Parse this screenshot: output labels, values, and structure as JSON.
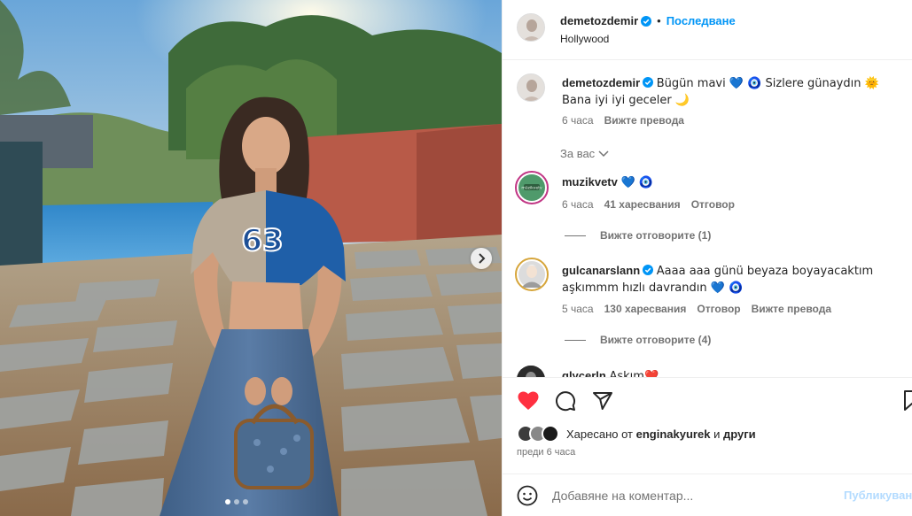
{
  "post": {
    "author": "demetozdemir",
    "follow_label": "Последване",
    "separator": "•",
    "location": "Hollywood",
    "caption_text": "Bügün mavi 💙 🧿 Sizlere günaydın 🌞 Bana iyi iyi geceler 🌙",
    "caption_time": "6 часа",
    "caption_translate": "Вижте превода",
    "for_you_label": "За вас",
    "jersey_number": "63"
  },
  "comments": [
    {
      "username": "muzikvetv",
      "text": "💙 🧿",
      "time": "6 часа",
      "likes": "41 харесвания",
      "reply": "Отговор",
      "view_replies": "Вижте отговорите (1)",
      "avatar_badge": "müzikvetv"
    },
    {
      "username": "gulcanarslann",
      "text": "Aaaa aaa günü beyaza boyayacaktım aşkımmm hızlı davrandın 💙 🧿",
      "time": "5 часа",
      "likes": "130 харесвания",
      "reply": "Отговор",
      "translate": "Вижте превода",
      "view_replies": "Вижте отговорите (4)"
    },
    {
      "username": "glycerln",
      "text": "Aşkım❤️"
    }
  ],
  "footer": {
    "liked_prefix": "Харесано от",
    "liked_user": "enginakyurek",
    "liked_and": "и",
    "liked_others": "други",
    "time_ago": "преди 6 часа",
    "comment_placeholder": "Добавяне на коментар...",
    "publish_label": "Публикуван"
  },
  "colors": {
    "accent": "#0095f6",
    "like_red": "#ff3040",
    "muted": "#737373",
    "border": "#efefef"
  },
  "icons": {
    "verified": "verified-badge-icon",
    "like": "heart-filled-icon",
    "comment": "speech-bubble-icon",
    "share": "paper-plane-icon",
    "save": "bookmark-icon",
    "emoji": "smiley-face-icon",
    "carousel_next": "chevron-right-icon",
    "for_you_chevron": "chevron-down-icon"
  },
  "carousel": {
    "slide_count": 3,
    "active_slide": 1
  }
}
